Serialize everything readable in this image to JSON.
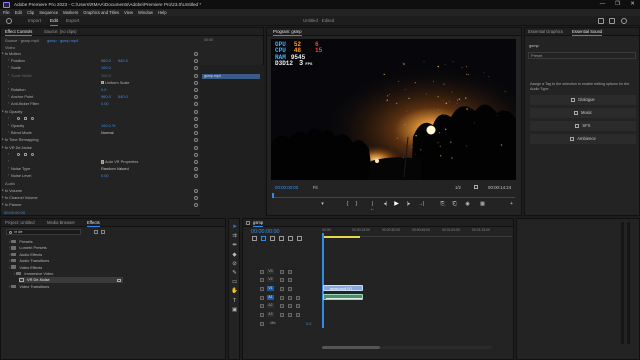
{
  "window": {
    "title": "Adobe Premiere Pro 2023 - C:\\Users\\RMAA\\Documents\\Adobe\\Premiere Pro\\23.0\\Untitled *",
    "controls": [
      "—",
      "❐",
      "✕"
    ]
  },
  "menu": [
    "File",
    "Edit",
    "Clip",
    "Sequence",
    "Markers",
    "Graphics and Titles",
    "View",
    "Window",
    "Help"
  ],
  "workspaces": {
    "tabs": [
      "Import",
      "Edit",
      "Export"
    ],
    "active": "Edit",
    "doc_title": "Untitled · Edited"
  },
  "effect_controls": {
    "tabs": [
      "Effect Controls",
      "Source: (no clips)"
    ],
    "source_label": "Source · gsmp.mp4",
    "clip_label": "gsmp · gsmp.mp4",
    "video_header": "Video",
    "keyframe_time": "00:00",
    "keyframe_clip": "gsmp.mp4",
    "rows": [
      {
        "type": "group",
        "label": "fx Motion"
      },
      {
        "type": "param",
        "label": "Position",
        "value": "960.0",
        "value2": "540.0"
      },
      {
        "type": "param",
        "label": "Scale",
        "value": "100.0"
      },
      {
        "type": "param",
        "label": "Scale Width",
        "value": "100.0",
        "dim": true
      },
      {
        "type": "check",
        "label": "Uniform Scale"
      },
      {
        "type": "param",
        "label": "Rotation",
        "value": "0.0"
      },
      {
        "type": "param",
        "label": "Anchor Point",
        "value": "960.0",
        "value2": "540.0"
      },
      {
        "type": "param",
        "label": "Anti-flicker Filter",
        "value": "0.00"
      },
      {
        "type": "group",
        "label": "fx Opacity"
      },
      {
        "type": "masks",
        "label": ""
      },
      {
        "type": "param",
        "label": "Opacity",
        "value": "100.0 %"
      },
      {
        "type": "select",
        "label": "Blend Mode",
        "value": "Normal"
      },
      {
        "type": "group",
        "label": "fx Time Remapping"
      },
      {
        "type": "group",
        "label": "fx VR De-Noise"
      },
      {
        "type": "masks",
        "label": ""
      },
      {
        "type": "check",
        "label": "Auto VR Properties"
      },
      {
        "type": "select",
        "label": "Noise Type",
        "value": "Random Valued"
      },
      {
        "type": "param",
        "label": "Noise Level",
        "value": "0.00"
      },
      {
        "type": "header",
        "label": "Audio"
      },
      {
        "type": "group",
        "label": "fx Volume"
      },
      {
        "type": "group",
        "label": "fx Channel Volume"
      },
      {
        "type": "group",
        "label": "fx Panner"
      }
    ],
    "timecode": "00:00:00:00"
  },
  "program_monitor": {
    "tab": "Program: gsmp",
    "osd": {
      "gpu_label": "GPU",
      "gpu_val": "52",
      "gpu_val2": "6",
      "cpu_label": "CPU",
      "cpu_val": "48",
      "cpu_val2": "15",
      "ram_label": "RAM",
      "ram_val": "9545",
      "d3d_label": "D3D12",
      "fps_val": "3",
      "fps_unit": "FPS"
    },
    "timecode": "00:00:00:00",
    "fit": "Fit",
    "resolution": "1/2",
    "duration": "00:00:14:24",
    "controls": [
      "▾",
      "{",
      "}",
      "|←",
      "◂|",
      "▶",
      "|▸",
      "→|",
      "⎘",
      "⎗",
      "◉",
      "▦",
      "+"
    ]
  },
  "essential_sound": {
    "tabs": [
      "Essential Graphics",
      "Essential Sound"
    ],
    "clip": "gsmp",
    "preset_label": "Preset",
    "description": "Assign a Tag to the selection to enable editing options for the Audio Type.",
    "buttons": [
      "Dialogue",
      "Music",
      "SFX",
      "Ambience"
    ]
  },
  "project": {
    "tabs": [
      "Project: Untitled",
      "Media Browser",
      "Effects"
    ],
    "search": "vr de",
    "items": [
      {
        "label": "Presets",
        "indent": 0
      },
      {
        "label": "Lumetri Presets",
        "indent": 0
      },
      {
        "label": "Audio Effects",
        "indent": 0
      },
      {
        "label": "Audio Transitions",
        "indent": 0
      },
      {
        "label": "Video Effects",
        "indent": 0
      },
      {
        "label": "Immersive Video",
        "indent": 1
      },
      {
        "label": "VR De-Noise",
        "indent": 2,
        "selected": true
      },
      {
        "label": "Video Transitions",
        "indent": 0
      }
    ]
  },
  "timeline": {
    "tab": "gsmp",
    "timecode": "00:00:00:00",
    "ruler": [
      "00:00",
      "00:00:15:00",
      "00:00:30:00",
      "00:00:45:00",
      "00:01:00:00",
      "00:01:15:00"
    ],
    "tracks": [
      {
        "name": "V3",
        "kind": "video"
      },
      {
        "name": "V2",
        "kind": "video"
      },
      {
        "name": "V1",
        "kind": "video",
        "active": true
      },
      {
        "name": "A1",
        "kind": "audio",
        "active": true
      },
      {
        "name": "A2",
        "kind": "audio"
      },
      {
        "name": "A3",
        "kind": "audio"
      },
      {
        "name": "Mix",
        "kind": "mix",
        "value": "0.0"
      }
    ],
    "clips": [
      {
        "label": "gsmp.mp4 [V]",
        "kind": "video"
      },
      {
        "label": "",
        "kind": "audio"
      }
    ]
  },
  "colors": {
    "accent": "#2d8ceb",
    "video_clip": "#8aa9d8",
    "audio_clip": "#4f8a6f",
    "playhead": "#2d8ceb",
    "osd_blue": "#3fb4ff",
    "osd_orange": "#ff9c2b",
    "osd_red": "#ff4040",
    "osd_white": "#f0f0f0"
  }
}
